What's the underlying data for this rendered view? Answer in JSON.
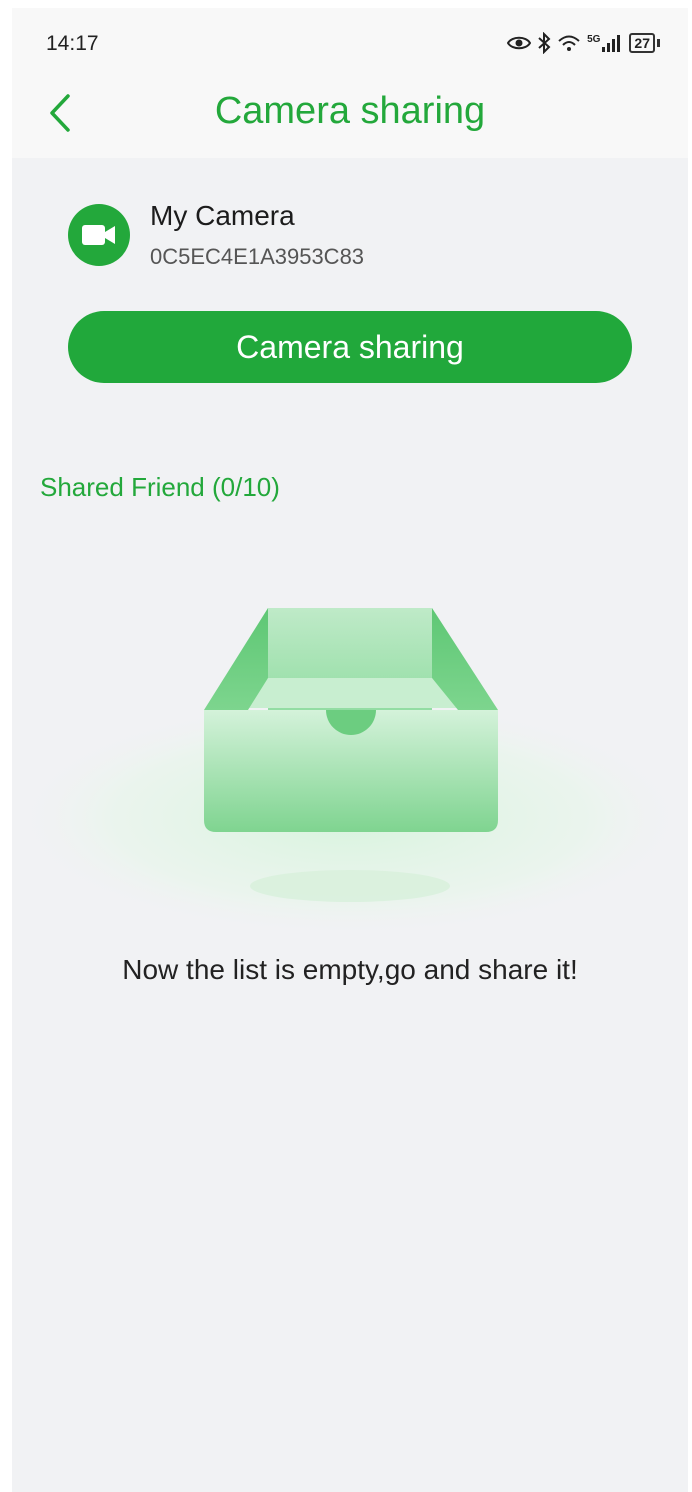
{
  "status_bar": {
    "time": "14:17",
    "network": "5G",
    "battery": "27",
    "icons": [
      "eye-icon",
      "bluetooth-icon",
      "wifi-icon",
      "signal-icon",
      "battery-icon"
    ]
  },
  "header": {
    "title": "Camera sharing",
    "back_icon": "chevron-left-icon"
  },
  "device": {
    "name": "My Camera",
    "id": "0C5EC4E1A3953C83",
    "icon": "video-camera-icon"
  },
  "share_button_label": "Camera sharing",
  "shared_friends": {
    "label": "Shared Friend (0/10)"
  },
  "empty_state": {
    "icon": "empty-box-icon",
    "message": "Now the list is empty,go and share it!"
  },
  "colors": {
    "accent": "#23a83b",
    "background": "#f1f2f4",
    "header_background": "#f8f8f8"
  }
}
